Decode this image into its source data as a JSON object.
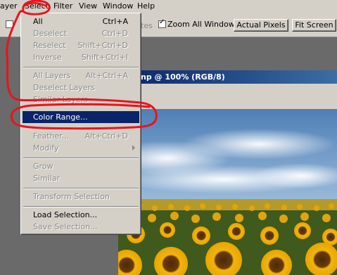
{
  "menubar": {
    "items": [
      {
        "label": "ayer",
        "key": "layer"
      },
      {
        "label": "Select",
        "key": "select"
      },
      {
        "label": "Filter",
        "key": "filter"
      },
      {
        "label": "View",
        "key": "view"
      },
      {
        "label": "Window",
        "key": "window"
      },
      {
        "label": "Help",
        "key": "help"
      }
    ]
  },
  "options": {
    "partial_label": "tes",
    "zoom_all_label": "Zoom All Windows",
    "zoom_all_checked": true,
    "actual_pixels_label": "Actual Pixels",
    "fit_screen_label": "Fit Screen"
  },
  "document": {
    "title": "np @ 100% (RGB/8)"
  },
  "select_menu": {
    "items": [
      {
        "label": "All",
        "shortcut": "Ctrl+A",
        "state": "enabled"
      },
      {
        "label": "Deselect",
        "shortcut": "Ctrl+D",
        "state": "disabled"
      },
      {
        "label": "Reselect",
        "shortcut": "Shift+Ctrl+D",
        "state": "disabled"
      },
      {
        "label": "Inverse",
        "shortcut": "Shift+Ctrl+I",
        "state": "disabled"
      },
      {
        "label": "All Layers",
        "shortcut": "Alt+Ctrl+A",
        "state": "disabled"
      },
      {
        "label": "Deselect Layers",
        "shortcut": "",
        "state": "disabled"
      },
      {
        "label": "Similar Layers",
        "shortcut": "",
        "state": "disabled"
      },
      {
        "label": "Color Range...",
        "shortcut": "",
        "state": "highlighted"
      },
      {
        "label": "Feather...",
        "shortcut": "Alt+Ctrl+D",
        "state": "disabled"
      },
      {
        "label": "Modify",
        "shortcut": "",
        "state": "disabled"
      },
      {
        "label": "Grow",
        "shortcut": "",
        "state": "disabled"
      },
      {
        "label": "Similar",
        "shortcut": "",
        "state": "disabled"
      },
      {
        "label": "Transform Selection",
        "shortcut": "",
        "state": "disabled"
      },
      {
        "label": "Load Selection...",
        "shortcut": "",
        "state": "enabled"
      },
      {
        "label": "Save Selection...",
        "shortcut": "",
        "state": "disabled"
      }
    ]
  },
  "annotation": {
    "color": "#e8141c"
  }
}
